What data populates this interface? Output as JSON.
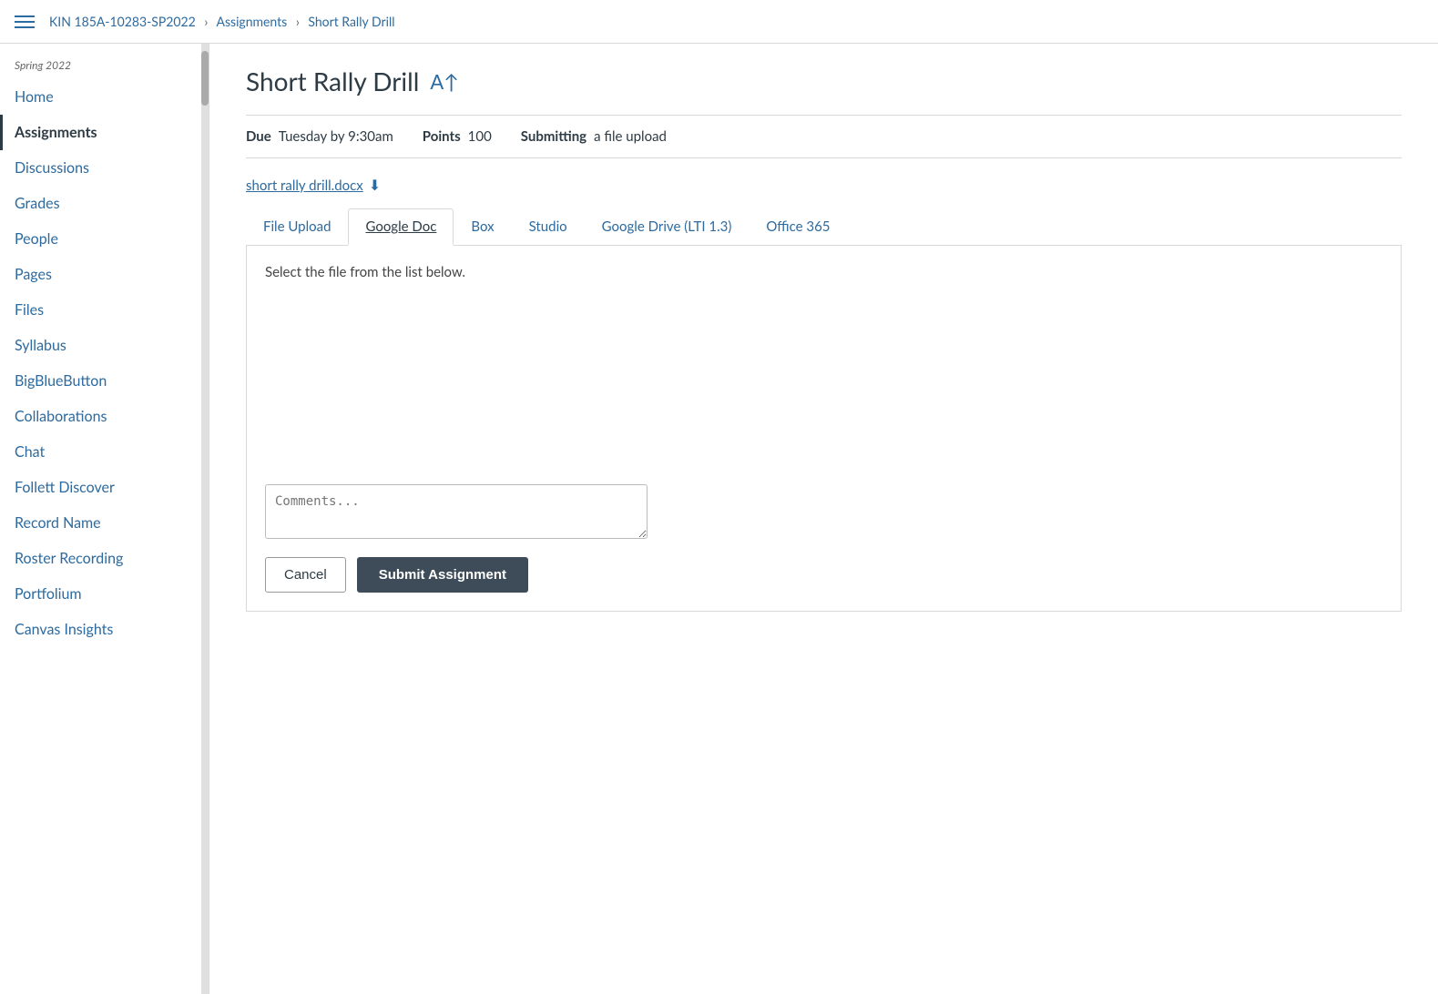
{
  "topbar": {
    "breadcrumb_course": "KIN 185A-10283-SP2022",
    "breadcrumb_assignments": "Assignments",
    "breadcrumb_current": "Short Rally Drill",
    "hamburger_label": "Menu"
  },
  "sidebar": {
    "season": "Spring 2022",
    "nav_items": [
      {
        "id": "home",
        "label": "Home",
        "active": false
      },
      {
        "id": "assignments",
        "label": "Assignments",
        "active": true
      },
      {
        "id": "discussions",
        "label": "Discussions",
        "active": false
      },
      {
        "id": "grades",
        "label": "Grades",
        "active": false
      },
      {
        "id": "people",
        "label": "People",
        "active": false
      },
      {
        "id": "pages",
        "label": "Pages",
        "active": false
      },
      {
        "id": "files",
        "label": "Files",
        "active": false
      },
      {
        "id": "syllabus",
        "label": "Syllabus",
        "active": false
      },
      {
        "id": "bigbluebutton",
        "label": "BigBlueButton",
        "active": false
      },
      {
        "id": "collaborations",
        "label": "Collaborations",
        "active": false
      },
      {
        "id": "chat",
        "label": "Chat",
        "active": false
      },
      {
        "id": "follett-discover",
        "label": "Follett Discover",
        "active": false
      },
      {
        "id": "record-name",
        "label": "Record Name",
        "active": false
      },
      {
        "id": "roster-recording",
        "label": "Roster Recording",
        "active": false
      },
      {
        "id": "portfolium",
        "label": "Portfolium",
        "active": false
      },
      {
        "id": "canvas-insights",
        "label": "Canvas Insights",
        "active": false
      }
    ]
  },
  "assignment": {
    "title": "Short Rally Drill",
    "title_icon": "A↑",
    "due_label": "Due",
    "due_value": "Tuesday by 9:30am",
    "points_label": "Points",
    "points_value": "100",
    "submitting_label": "Submitting",
    "submitting_value": "a file upload",
    "file_name": "short rally drill.docx",
    "download_icon": "⬇"
  },
  "tabs": [
    {
      "id": "file-upload",
      "label": "File Upload",
      "active": false
    },
    {
      "id": "google-doc",
      "label": "Google Doc",
      "active": true
    },
    {
      "id": "box",
      "label": "Box",
      "active": false
    },
    {
      "id": "studio",
      "label": "Studio",
      "active": false
    },
    {
      "id": "google-drive",
      "label": "Google Drive (LTI 1.3)",
      "active": false
    },
    {
      "id": "office-365",
      "label": "Office 365",
      "active": false
    }
  ],
  "submission": {
    "hint": "Select the file from the list below.",
    "comments_placeholder": "Comments..."
  },
  "buttons": {
    "cancel": "Cancel",
    "submit": "Submit Assignment"
  }
}
